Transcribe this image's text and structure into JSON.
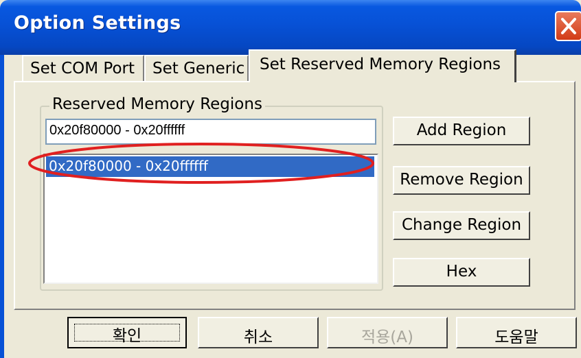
{
  "window": {
    "title": "Option Settings"
  },
  "tabs": [
    {
      "label": "Set COM Port",
      "active": false
    },
    {
      "label": "Set Generic",
      "active": false
    },
    {
      "label": "Set Reserved Memory Regions",
      "active": true
    }
  ],
  "group": {
    "label": "Reserved Memory Regions",
    "input_value": "0x20f80000 - 0x20ffffff",
    "list_items": [
      "0x20f80000 - 0x20ffffff"
    ],
    "selected_index": 0
  },
  "side_buttons": {
    "add": "Add Region",
    "remove": "Remove Region",
    "change": "Change Region",
    "hex": "Hex"
  },
  "dialog_buttons": {
    "ok": "확인",
    "cancel": "취소",
    "apply": "적용(A)",
    "help": "도움말"
  },
  "colors": {
    "title_bar": "#0751d6",
    "selection": "#316ac5",
    "annotation": "#e02020"
  }
}
